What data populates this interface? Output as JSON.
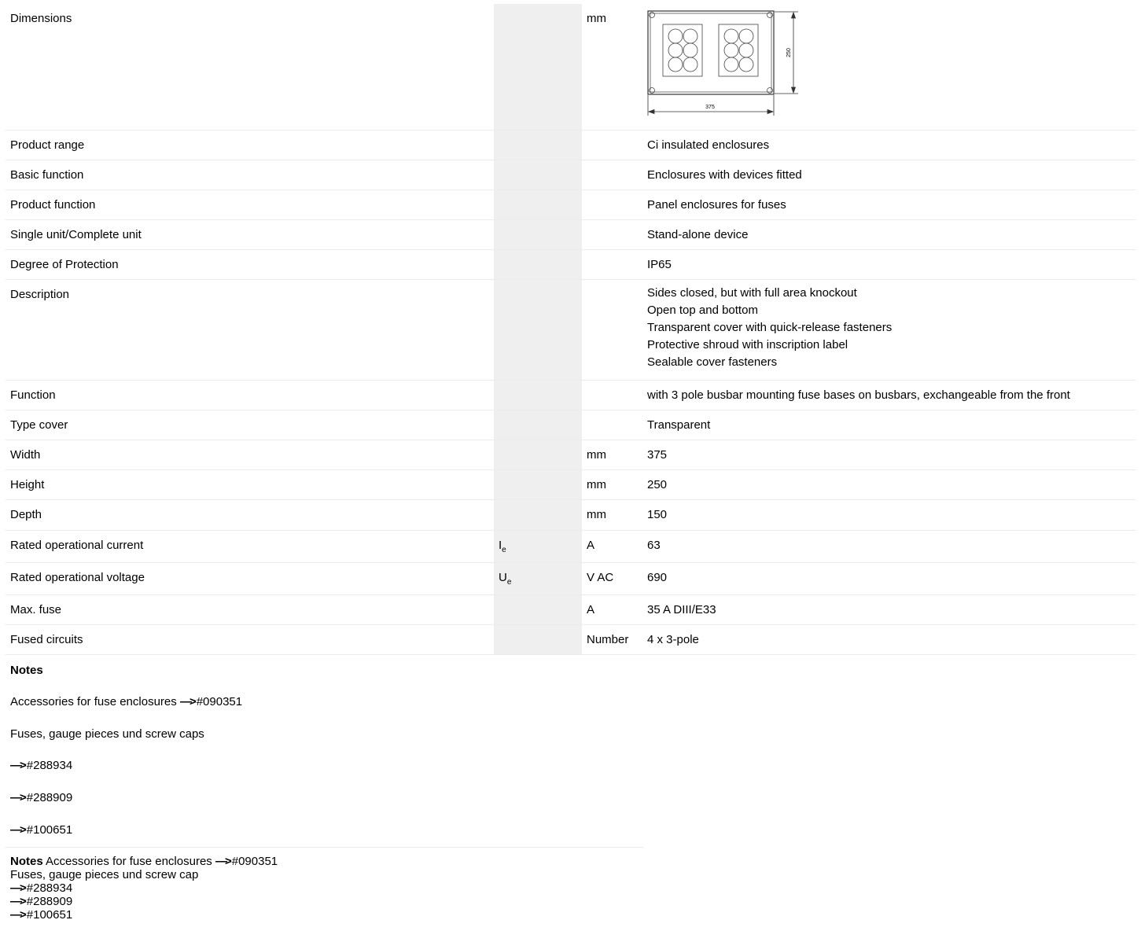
{
  "rows": [
    {
      "label": "Dimensions",
      "sym": "",
      "unit": "mm",
      "value": "",
      "drawing": true
    },
    {
      "label": "Product range",
      "sym": "",
      "unit": "",
      "value": "Ci insulated enclosures"
    },
    {
      "label": "Basic function",
      "sym": "",
      "unit": "",
      "value": "Enclosures with devices fitted"
    },
    {
      "label": "Product function",
      "sym": "",
      "unit": "",
      "value": "Panel enclosures for fuses"
    },
    {
      "label": "Single unit/Complete unit",
      "sym": "",
      "unit": "",
      "value": "Stand-alone device"
    },
    {
      "label": "Degree of Protection",
      "sym": "",
      "unit": "",
      "value": "IP65"
    },
    {
      "label": "Description",
      "sym": "",
      "unit": "",
      "value": [
        "Sides closed, but with full area knockout",
        "Open top and bottom",
        "Transparent cover with quick-release fasteners",
        "Protective shroud with inscription label",
        "Sealable cover fasteners"
      ]
    },
    {
      "label": "Function",
      "sym": "",
      "unit": "",
      "value": "with 3 pole busbar mounting fuse bases on busbars, exchangeable from the front"
    },
    {
      "label": "Type cover",
      "sym": "",
      "unit": "",
      "value": "Transparent"
    },
    {
      "label": "Width",
      "sym": "",
      "unit": "mm",
      "value": "375"
    },
    {
      "label": "Height",
      "sym": "",
      "unit": "mm",
      "value": "250"
    },
    {
      "label": "Depth",
      "sym": "",
      "unit": "mm",
      "value": "150"
    },
    {
      "label": "Rated operational current",
      "sym": "I",
      "sub": "e",
      "unit": "A",
      "value": "63"
    },
    {
      "label": "Rated operational voltage",
      "sym": "U",
      "sub": "e",
      "unit": "V AC",
      "value": "690"
    },
    {
      "label": "Max. fuse",
      "sym": "",
      "unit": "A",
      "value": "35 A DIII/E33"
    },
    {
      "label": "Fused circuits",
      "sym": "",
      "unit": "Number",
      "value": "4 x 3-pole"
    }
  ],
  "drawing": {
    "width_label": "375",
    "height_label": "250"
  },
  "notes": {
    "heading": "Notes",
    "lines": [
      "Accessories for fuse enclosures ",
      "#090351",
      "Fuses, gauge pieces und screw caps",
      "#288934",
      "#288909",
      "#100651"
    ],
    "arrow": "—>"
  },
  "notes2": {
    "heading": "Notes",
    "line1": "Accessories for fuse enclosures ",
    "ref1": "#090351",
    "line2": "Fuses, gauge pieces und screw cap",
    "refs": [
      "#288934",
      "#288909",
      "#100651"
    ]
  }
}
